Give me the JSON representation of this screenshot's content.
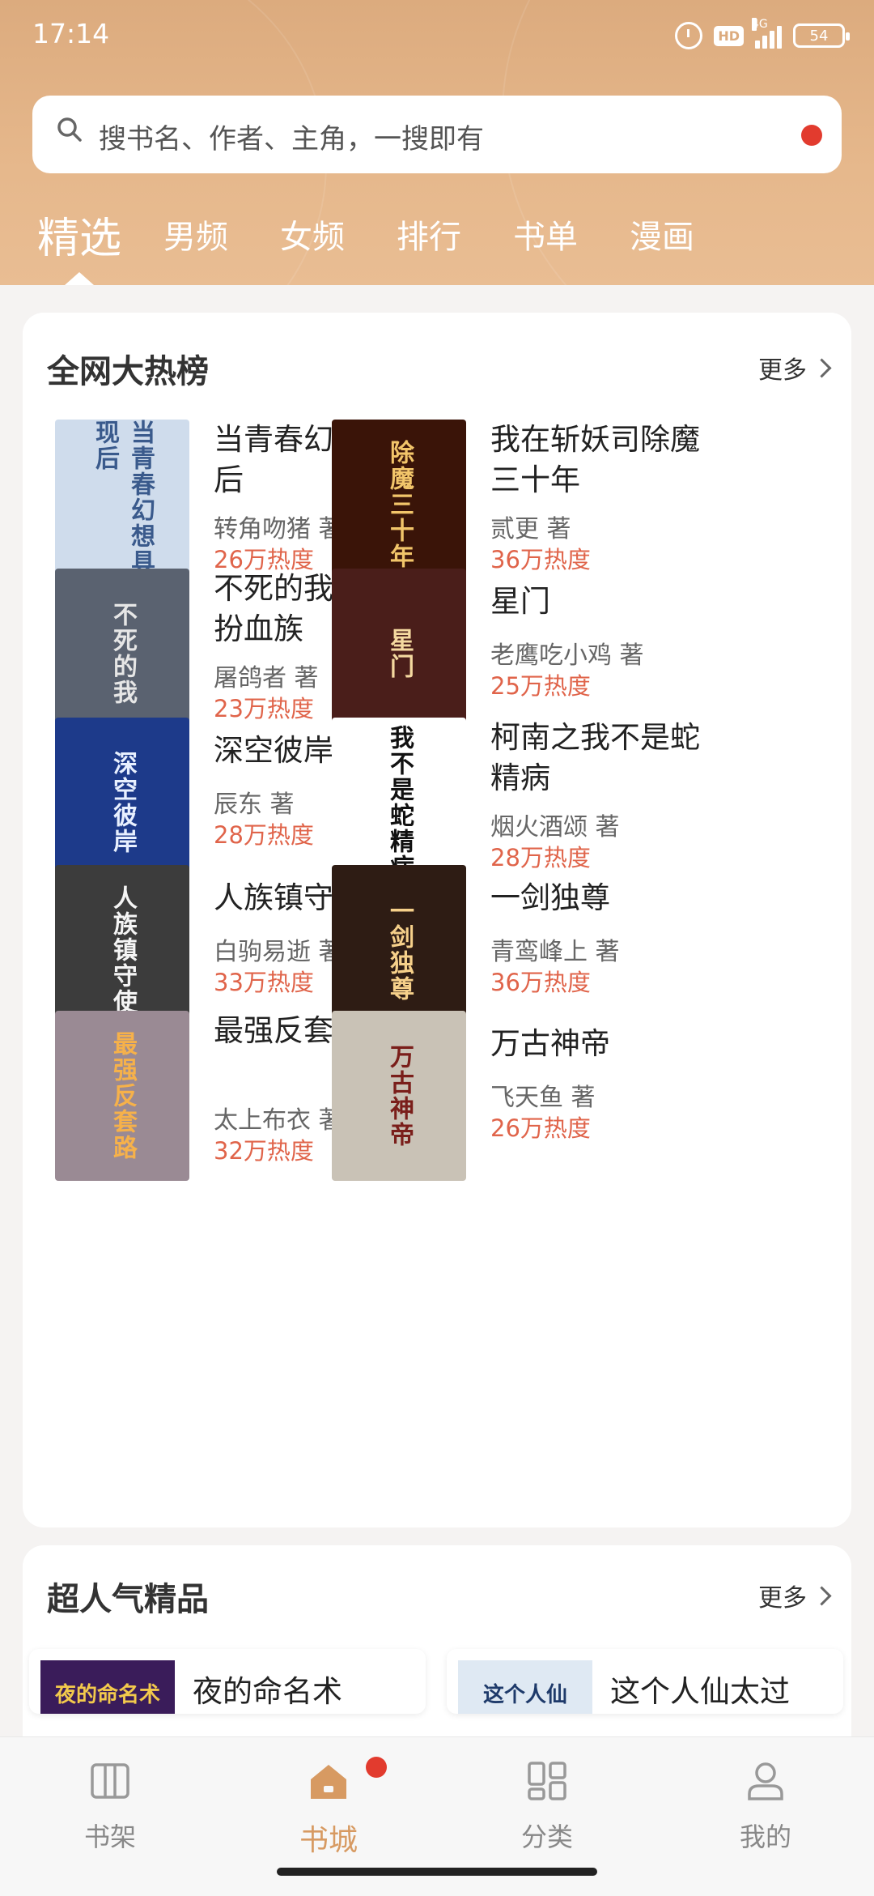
{
  "status_bar": {
    "time": "17:14",
    "network": "4G",
    "hd": "HD",
    "battery": "54"
  },
  "search": {
    "placeholder": "搜书名、作者、主角，一搜即有"
  },
  "tabs": [
    {
      "label": "精选",
      "active": true
    },
    {
      "label": "男频",
      "active": false
    },
    {
      "label": "女频",
      "active": false
    },
    {
      "label": "排行",
      "active": false
    },
    {
      "label": "书单",
      "active": false
    },
    {
      "label": "漫画",
      "active": false
    }
  ],
  "hot_list": {
    "title": "全网大热榜",
    "more": "更多",
    "books": [
      {
        "title": "当青春幻想具现后",
        "author": "转角吻猪 著",
        "heat": "26万热度",
        "cover_text": "当青春幻想具现后",
        "cover_bg": "#cfdcec",
        "cover_fg": "#3a5a8c"
      },
      {
        "title": "我在斩妖司除魔三十年",
        "author": "贰更 著",
        "heat": "36万热度",
        "cover_text": "除魔三十年",
        "cover_bg": "#3a1408",
        "cover_fg": "#f2c56a"
      },
      {
        "title": "不死的我只好假扮血族",
        "author": "屠鸽者 著",
        "heat": "23万热度",
        "cover_text": "不死的我",
        "cover_bg": "#5a6270",
        "cover_fg": "#e6e6e6"
      },
      {
        "title": "星门",
        "author": "老鹰吃小鸡 著",
        "heat": "25万热度",
        "cover_text": "星门",
        "cover_bg": "#4a1e1a",
        "cover_fg": "#f4d9a0"
      },
      {
        "title": "深空彼岸",
        "author": "辰东 著",
        "heat": "28万热度",
        "cover_text": "深空彼岸",
        "cover_bg": "#1d3a8a",
        "cover_fg": "#e8f0ff"
      },
      {
        "title": "柯南之我不是蛇精病",
        "author": "烟火酒颂 著",
        "heat": "28万热度",
        "cover_text": "我不是蛇精病",
        "cover_bg": "#ffffff",
        "cover_fg": "#111111"
      },
      {
        "title": "人族镇守使",
        "author": "白驹易逝 著",
        "heat": "33万热度",
        "cover_text": "人族镇守使",
        "cover_bg": "#3c3c3c",
        "cover_fg": "#f5f5f5"
      },
      {
        "title": "一剑独尊",
        "author": "青鸾峰上 著",
        "heat": "36万热度",
        "cover_text": "一剑独尊",
        "cover_bg": "#2e1c14",
        "cover_fg": "#f6d08a"
      },
      {
        "title": "最强反套路系统",
        "author": "太上布衣 著",
        "heat": "32万热度",
        "cover_text": "最强反套路",
        "cover_bg": "#9a8a94",
        "cover_fg": "#f6b14a"
      },
      {
        "title": "万古神帝",
        "author": "飞天鱼 著",
        "heat": "26万热度",
        "cover_text": "万古神帝",
        "cover_bg": "#c9c2b6",
        "cover_fg": "#7a1e1a"
      }
    ]
  },
  "popular": {
    "title": "超人气精品",
    "more": "更多",
    "books": [
      {
        "title": "夜的命名术",
        "cover_text": "夜的命名术",
        "cover_bg": "#3a1c5a",
        "cover_fg": "#f2c94c"
      },
      {
        "title": "这个人仙太过",
        "cover_text": "这个人仙",
        "cover_bg": "#dfe9f3",
        "cover_fg": "#1e3a6a"
      }
    ]
  },
  "bottom_nav": [
    {
      "label": "书架",
      "icon": "bookshelf-icon",
      "active": false
    },
    {
      "label": "书城",
      "icon": "home-icon",
      "active": true
    },
    {
      "label": "分类",
      "icon": "category-icon",
      "active": false
    },
    {
      "label": "我的",
      "icon": "profile-icon",
      "active": false
    }
  ],
  "colors": {
    "header_bg": "#e2b286",
    "accent": "#d79a62",
    "heat": "#e0644a",
    "badge": "#e23b2e"
  }
}
